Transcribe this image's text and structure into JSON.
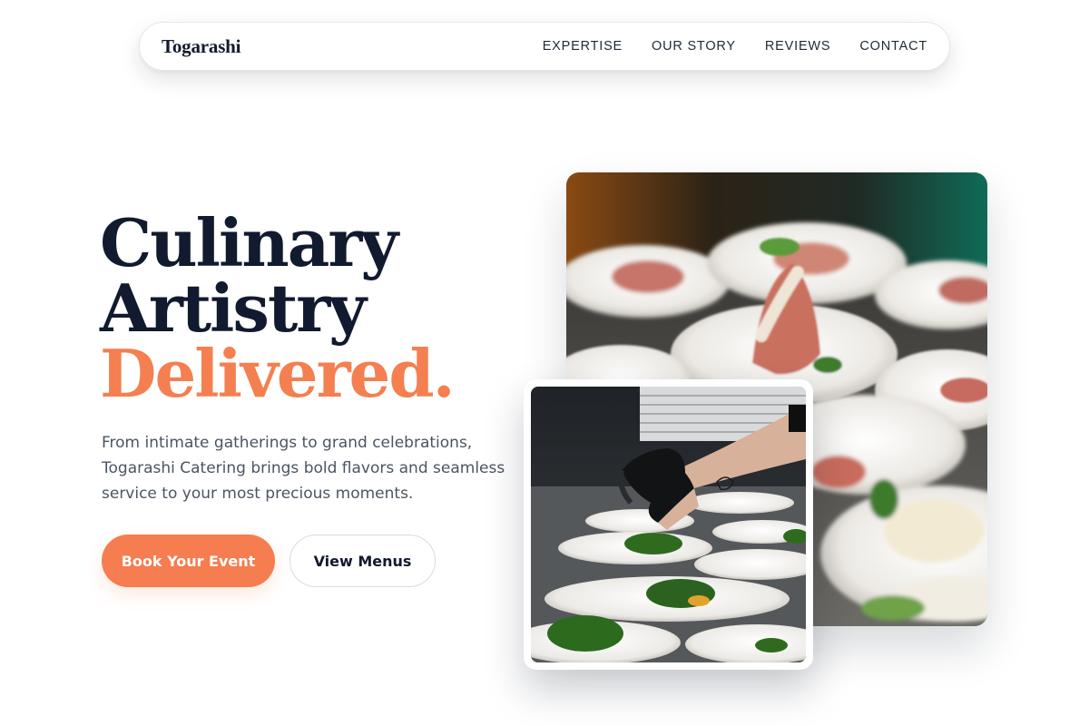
{
  "nav": {
    "brand": "Togarashi",
    "links": [
      {
        "label": "EXPERTISE"
      },
      {
        "label": "OUR STORY"
      },
      {
        "label": "REVIEWS"
      },
      {
        "label": "CONTACT"
      }
    ]
  },
  "hero": {
    "headline_line1": "Culinary",
    "headline_line2": "Artistry",
    "headline_accent": "Delivered.",
    "subtitle": "From intimate gatherings to grand celebrations, Togarashi Catering brings bold flavors and seamless service to your most precious moments.",
    "primary_cta": "Book Your Event",
    "secondary_cta": "View Menus"
  },
  "images": {
    "large": "plated-appetizers-photo",
    "small": "chef-plating-photo"
  },
  "colors": {
    "accent": "#f47f50",
    "heading": "#111a2e",
    "body_text": "#4b5563"
  }
}
